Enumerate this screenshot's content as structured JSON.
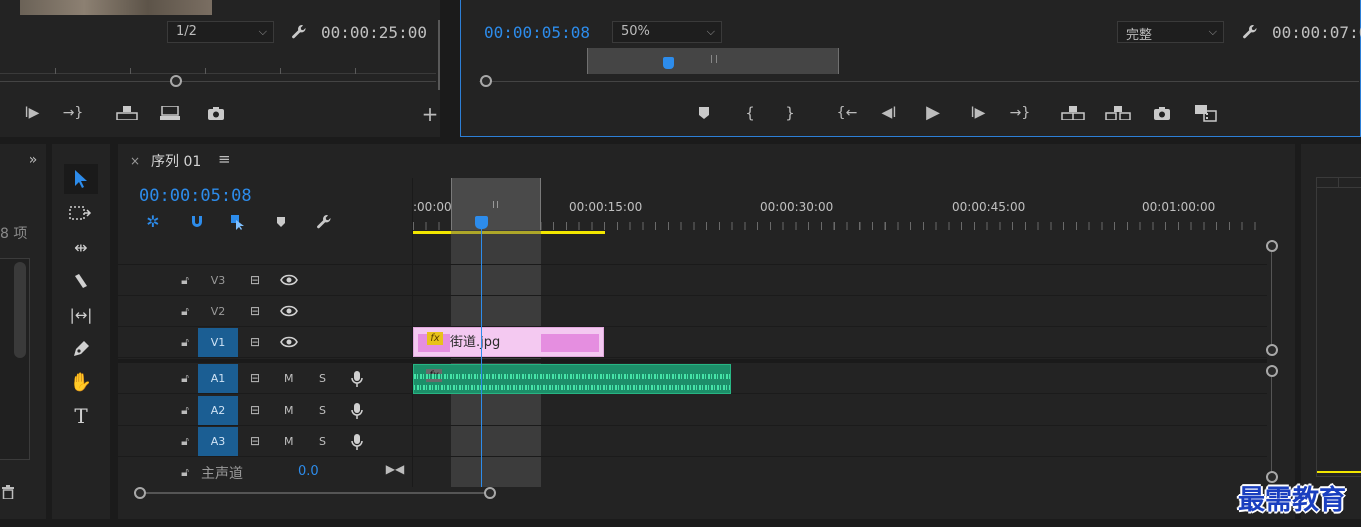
{
  "source_monitor": {
    "zoom_select": "1/2",
    "timecode": "00:00:25:00"
  },
  "program_monitor": {
    "timecode": "00:00:05:08",
    "zoom_select": "50%",
    "quality_select": "完整",
    "duration": "00:00:07:0"
  },
  "project_panel": {
    "item_count": "8 项"
  },
  "sequence": {
    "tab_title": "序列 01",
    "timecode": "00:00:05:08",
    "ruler_labels": [
      ":00:00",
      "00:00:15:00",
      "00:00:30:00",
      "00:00:45:00",
      "00:01:00:00"
    ],
    "tracks": {
      "video": [
        {
          "label": "V3",
          "active": false
        },
        {
          "label": "V2",
          "active": false
        },
        {
          "label": "V1",
          "active": true
        }
      ],
      "audio": [
        {
          "label": "A1",
          "active": true,
          "m": "M",
          "s": "S"
        },
        {
          "label": "A2",
          "active": true,
          "m": "M",
          "s": "S"
        },
        {
          "label": "A3",
          "active": true,
          "m": "M",
          "s": "S"
        }
      ],
      "master": {
        "label": "主声道",
        "value": "0.0"
      }
    },
    "clips": {
      "video_clip": {
        "name": "街道.jpg",
        "fx": "fx"
      },
      "audio_clip": {
        "fx": "fx"
      }
    }
  },
  "watermark": "最需教育",
  "colors": {
    "accent_blue": "#2d8ceb",
    "video_clip": "#e58ee0",
    "audio_clip": "#1fa87a",
    "work_area": "#f2e600"
  }
}
